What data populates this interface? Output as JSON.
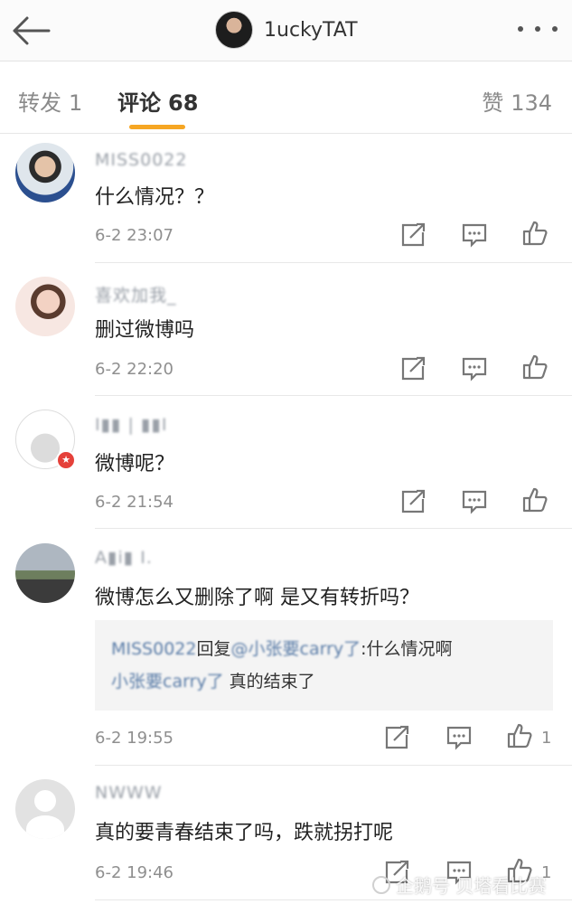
{
  "header": {
    "title": "1uckyTAT"
  },
  "tabs": [
    {
      "label": "转发",
      "count": "1"
    },
    {
      "label": "评论",
      "count": "68"
    },
    {
      "label": "赞",
      "count": "134"
    }
  ],
  "comments": [
    {
      "user": "MISS0022",
      "text": "什么情况？？",
      "time": "6-2 23:07",
      "likes": ""
    },
    {
      "user": "喜欢加我_",
      "text": "删过微博吗",
      "time": "6-2 22:20",
      "likes": ""
    },
    {
      "user": "I▮▮ | ▮▮I",
      "text": "微博呢？",
      "time": "6-2 21:54",
      "likes": ""
    },
    {
      "user": "A▮i▮ I.",
      "text": "微博怎么又删除了啊   是又有转折吗？",
      "time": "6-2 19:55",
      "likes": "1",
      "replies": [
        {
          "user": "MISS0022",
          "mid": "回复",
          "target": "@小张要carry了",
          "text": ":什么情况啊"
        },
        {
          "user": "小张要carry了",
          "mid": "",
          "target": "",
          "text": "真的结束了"
        }
      ]
    },
    {
      "user": "NWWW",
      "text": "真的要青春结束了吗，跌就拐打呢",
      "time": "6-2 19:46",
      "likes": "1"
    }
  ],
  "watermark": "企鹅号 贝塔看比赛",
  "colors": {
    "accent": "#f6a623",
    "link": "#5b7da8",
    "badge": "#e5413a"
  }
}
